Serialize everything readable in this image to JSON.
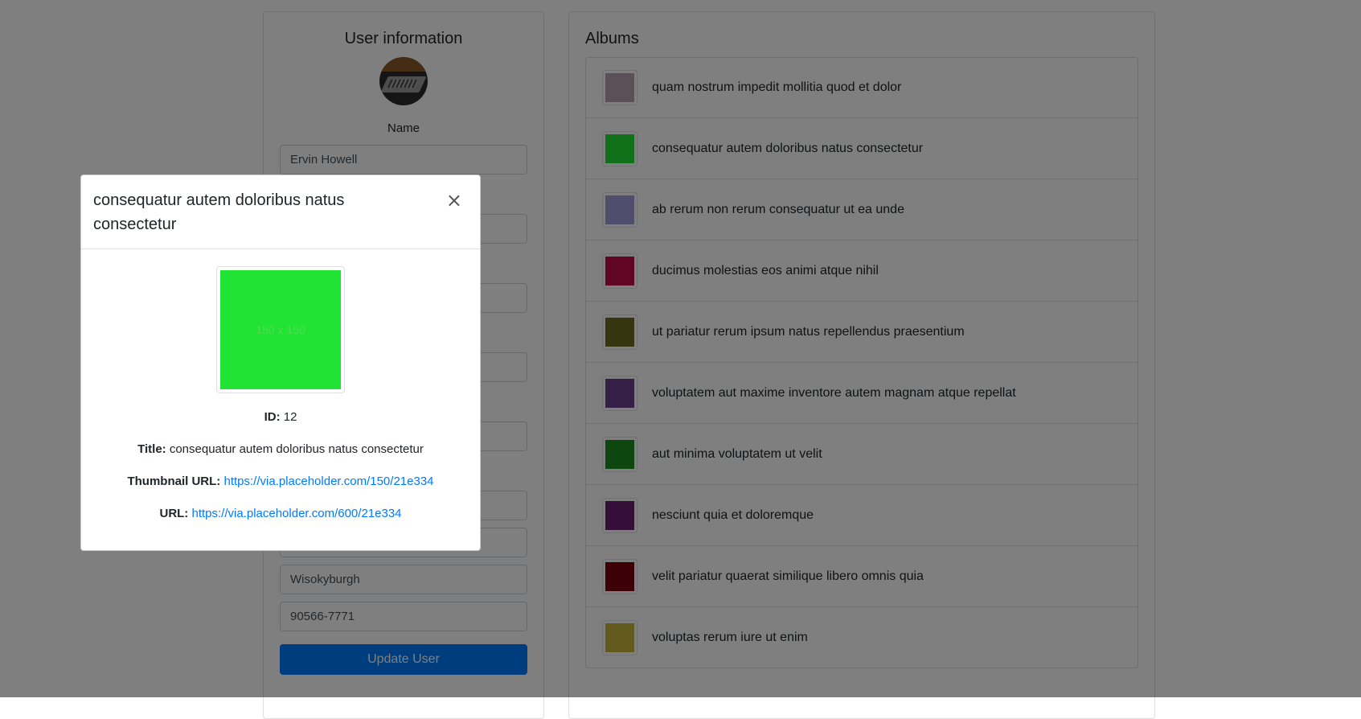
{
  "user_panel": {
    "title": "User information",
    "name_label": "Name",
    "fields": [
      {
        "value": "Ervin Howell"
      },
      {
        "value": ""
      },
      {
        "value": ""
      },
      {
        "value": ""
      },
      {
        "value": ""
      },
      {
        "value": ""
      },
      {
        "value": ""
      },
      {
        "value": "Wisokyburgh"
      },
      {
        "value": "90566-7771"
      }
    ],
    "update_button": "Update User"
  },
  "albums_panel": {
    "title": "Albums",
    "items": [
      {
        "title": "quam nostrum impedit mollitia quod et dolor",
        "color": "#b7a0b0"
      },
      {
        "title": "consequatur autem doloribus natus consectetur",
        "color": "#21e334"
      },
      {
        "title": "ab rerum non rerum consequatur ut ea unde",
        "color": "#9f9cd8"
      },
      {
        "title": "ducimus molestias eos animi atque nihil",
        "color": "#c20a4a"
      },
      {
        "title": "ut pariatur rerum ipsum natus repellendus praesentium",
        "color": "#6e6b1f"
      },
      {
        "title": "voluptatem aut maxime inventore autem magnam atque repellat",
        "color": "#6d3f8c"
      },
      {
        "title": "aut minima voluptatem ut velit",
        "color": "#1b8f1e"
      },
      {
        "title": "nesciunt quia et doloremque",
        "color": "#6c1f70"
      },
      {
        "title": "velit pariatur quaerat similique libero omnis quia",
        "color": "#7a000e"
      },
      {
        "title": "voluptas rerum iure ut enim",
        "color": "#c7b43c"
      }
    ]
  },
  "modal": {
    "title": "consequatur autem doloribus natus consectetur",
    "close_symbol": "×",
    "image_text": "150 x 150",
    "image_color": "#21e334",
    "id_label": "ID:",
    "id_value": "12",
    "title_label": "Title:",
    "title_value": "consequatur autem doloribus natus consectetur",
    "thumbnail_label": "Thumbnail URL:",
    "thumbnail_url": "https://via.placeholder.com/150/21e334",
    "url_label": "URL:",
    "url_value": "https://via.placeholder.com/600/21e334"
  }
}
